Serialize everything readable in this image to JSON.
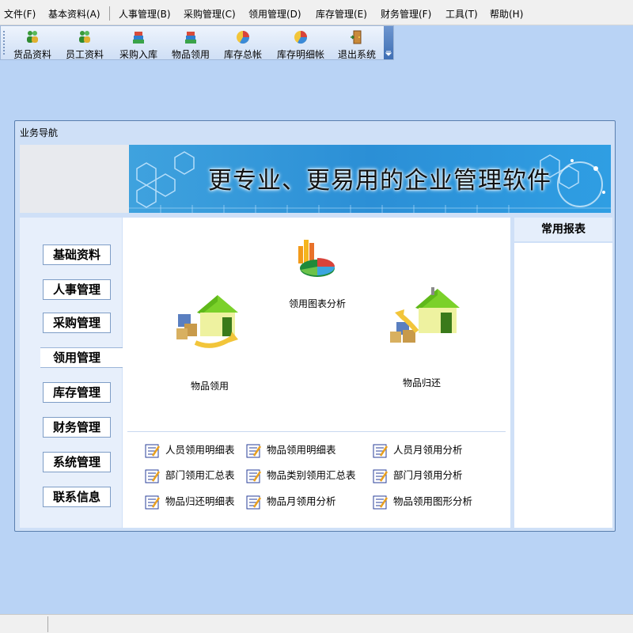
{
  "menubar": {
    "items": [
      "文件(F)",
      "基本资料(A)",
      "人事管理(B)",
      "采购管理(C)",
      "领用管理(D)",
      "库存管理(E)",
      "财务管理(F)",
      "工具(T)",
      "帮助(H)"
    ]
  },
  "toolbar": {
    "buttons": [
      {
        "label": "货品资料",
        "icon": "people-icon"
      },
      {
        "label": "员工资料",
        "icon": "people-icon"
      },
      {
        "label": "采购入库",
        "icon": "books-icon"
      },
      {
        "label": "物品领用",
        "icon": "books-icon"
      },
      {
        "label": "库存总帐",
        "icon": "pie-chart-icon"
      },
      {
        "label": "库存明细帐",
        "icon": "pie-chart-icon"
      },
      {
        "label": "退出系统",
        "icon": "exit-door-icon"
      }
    ]
  },
  "panel": {
    "title": "业务导航",
    "banner_text": "更专业、更易用的企业管理软件"
  },
  "nav": {
    "items": [
      "基础资料",
      "人事管理",
      "采购管理",
      "领用管理",
      "库存管理",
      "财务管理",
      "系统管理",
      "联系信息"
    ],
    "active": "领用管理"
  },
  "content": {
    "modules": [
      {
        "label": "领用图表分析",
        "icon": "chart-analysis-icon"
      },
      {
        "label": "物品领用",
        "icon": "warehouse-in-icon"
      },
      {
        "label": "物品归还",
        "icon": "warehouse-return-icon"
      }
    ],
    "reports": [
      "人员领用明细表",
      "物品领用明细表",
      "人员月领用分析",
      "部门领用汇总表",
      "物品类别领用汇总表",
      "部门月领用分析",
      "物品归还明细表",
      "物品月领用分析",
      "物品领用图形分析"
    ]
  },
  "right_panel": {
    "title": "常用报表"
  },
  "colors": {
    "background": "#b9d3f5",
    "banner_blue": "#2b8fd6",
    "panel_bg": "#cfe0f7"
  }
}
